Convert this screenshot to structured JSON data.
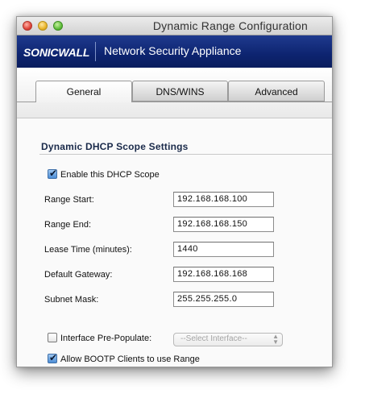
{
  "window": {
    "title": "Dynamic Range Configuration"
  },
  "banner": {
    "logo": "SONICWALL",
    "product": "Network Security Appliance"
  },
  "tabs": [
    {
      "label": "General",
      "active": true
    },
    {
      "label": "DNS/WINS",
      "active": false
    },
    {
      "label": "Advanced",
      "active": false
    }
  ],
  "section": {
    "title": "Dynamic DHCP Scope Settings"
  },
  "enable_scope": {
    "label": "Enable this DHCP Scope",
    "checked": true
  },
  "fields": {
    "range_start": {
      "label": "Range Start:",
      "value": "192.168.168.100"
    },
    "range_end": {
      "label": "Range End:",
      "value": "192.168.168.150"
    },
    "lease_time": {
      "label": "Lease Time (minutes):",
      "value": "1440"
    },
    "default_gateway": {
      "label": "Default Gateway:",
      "value": "192.168.168.168"
    },
    "subnet_mask": {
      "label": "Subnet Mask:",
      "value": "255.255.255.0"
    }
  },
  "interface_prepopulate": {
    "label": "Interface Pre-Populate:",
    "checked": false,
    "select_value": "--Select Interface--"
  },
  "allow_bootp": {
    "label": "Allow BOOTP Clients to use Range",
    "checked": true
  },
  "colors": {
    "banner": "#0d2470",
    "accent_check": "#4d8ed6"
  }
}
